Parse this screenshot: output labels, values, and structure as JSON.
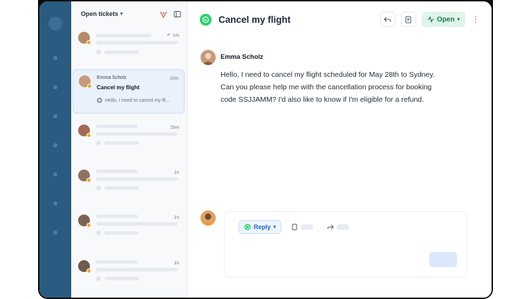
{
  "ticket_list": {
    "title": "Open tickets",
    "tickets": [
      {
        "name": "",
        "subject": "",
        "preview": "",
        "time": "1m"
      },
      {
        "name": "Emma Scholz",
        "subject": "Cancel my flight",
        "preview": "Hello, I need to cancel my fli...",
        "time": "10m"
      },
      {
        "name": "",
        "subject": "",
        "preview": "",
        "time": "25m"
      },
      {
        "name": "",
        "subject": "",
        "preview": "",
        "time": "1h"
      },
      {
        "name": "",
        "subject": "",
        "preview": "",
        "time": "1h"
      },
      {
        "name": "",
        "subject": "",
        "preview": "",
        "time": "1h"
      }
    ]
  },
  "conversation": {
    "title": "Cancel my flight",
    "status": "Open",
    "channel_icon": "whatsapp-icon",
    "message": {
      "author": "Emma Scholz",
      "body": "Hello, I need to cancel my flight scheduled for May 28th to Sydney. Can you please help me with the cancellation process for booking code SSJJAMM? I'd also like to know if I'm eligible for a refund."
    }
  },
  "composer": {
    "reply_label": "Reply"
  },
  "colors": {
    "rail": "#2a5b80",
    "whatsapp": "#25d366",
    "status_bg": "#dff4ea",
    "status_text": "#177a4f",
    "accent": "#1e66c8",
    "badge": "#f5a623"
  }
}
